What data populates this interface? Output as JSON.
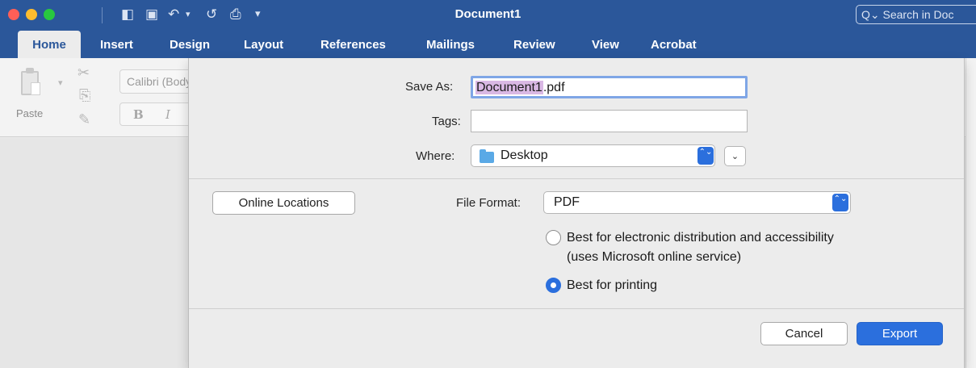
{
  "window": {
    "title": "Document1",
    "search_placeholder": "Search in Doc",
    "search_glyph": "Q⌄"
  },
  "quick_access": {
    "sidebar_glyph": "◧",
    "save_glyph": "▣",
    "undo_glyph": "↶",
    "undo_arrow_glyph": "▾",
    "redo_glyph": "↺",
    "print_glyph": "⎙",
    "customize_glyph": "▾"
  },
  "tabs": [
    {
      "label": "Home",
      "active": true
    },
    {
      "label": "Insert"
    },
    {
      "label": "Design"
    },
    {
      "label": "Layout"
    },
    {
      "label": "References"
    },
    {
      "label": "Mailings"
    },
    {
      "label": "Review"
    },
    {
      "label": "View"
    },
    {
      "label": "Acrobat"
    }
  ],
  "ribbon": {
    "paste_label": "Paste",
    "font_name": "Calibri (Body)",
    "bold_label": "B",
    "italic_label": "I",
    "cut_glyph": "✂",
    "copy_glyph": "⎘",
    "brush_glyph": "✎",
    "paste_arrow_glyph": "▾"
  },
  "dialog": {
    "save_as_label": "Save As:",
    "file_name_selected": "Document1",
    "file_name_ext": ".pdf",
    "tags_label": "Tags:",
    "tags_value": "",
    "where_label": "Where:",
    "where_value": "Desktop",
    "online_locations_button": "Online Locations",
    "file_format_label": "File Format:",
    "file_format_value": "PDF",
    "options": [
      {
        "line1": "Best for electronic distribution and accessibility",
        "line2": "(uses Microsoft online service)",
        "selected": false
      },
      {
        "line1": "Best for printing",
        "selected": true
      }
    ],
    "cancel_button": "Cancel",
    "export_button": "Export",
    "stepper_glyph": "⌃⌄",
    "expand_glyph": "⌄"
  },
  "colors": {
    "ribbon_blue": "#2b579a",
    "accent_blue": "#2b6fdd",
    "selection": "#d9b8e4"
  }
}
